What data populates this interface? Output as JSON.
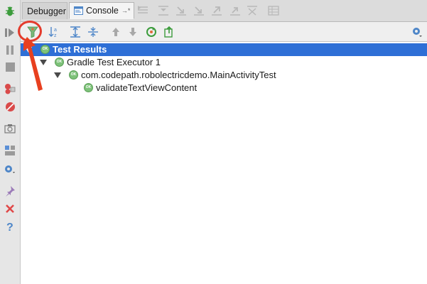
{
  "tabs": {
    "debugger_label": "Debugger",
    "console_label": "Console",
    "console_pin": "→*"
  },
  "tree": {
    "nodes": [
      {
        "label": "Test Results",
        "status": "OK",
        "expanded": true,
        "selected": true
      },
      {
        "label": "Gradle Test Executor 1",
        "status": "OK",
        "expanded": true,
        "selected": false
      },
      {
        "label": "com.codepath.robolectricdemo.MainActivityTest",
        "status": "OK",
        "expanded": true,
        "selected": false
      },
      {
        "label": "validateTextViewContent",
        "status": "OK",
        "expanded": false,
        "selected": false
      }
    ]
  },
  "icons": {
    "left_strip": [
      "bug-icon",
      "run-icon",
      "pause-icon",
      "stop-icon",
      "breakpoints-icon",
      "mute-breakpoints-icon",
      "camera-icon",
      "layout-icon",
      "settings-icon",
      "pin-icon",
      "close-icon",
      "help-icon"
    ],
    "tab_row": [
      "show-execution-point-icon",
      "step-over-icon",
      "step-into-icon",
      "force-step-into-icon",
      "step-out-icon",
      "drop-frame-icon",
      "run-to-cursor-icon",
      "evaluate-icon"
    ],
    "console_toolbar": [
      "filter-passed-icon",
      "sort-alpha-icon",
      "expand-all-icon",
      "collapse-all-icon",
      "previous-failed-icon",
      "next-failed-icon",
      "rerun-icon",
      "export-icon",
      "settings-icon"
    ]
  },
  "colors": {
    "selection": "#2e6fd6",
    "ok_badge": "#7ec27a",
    "annotation": "#e43b2c"
  }
}
